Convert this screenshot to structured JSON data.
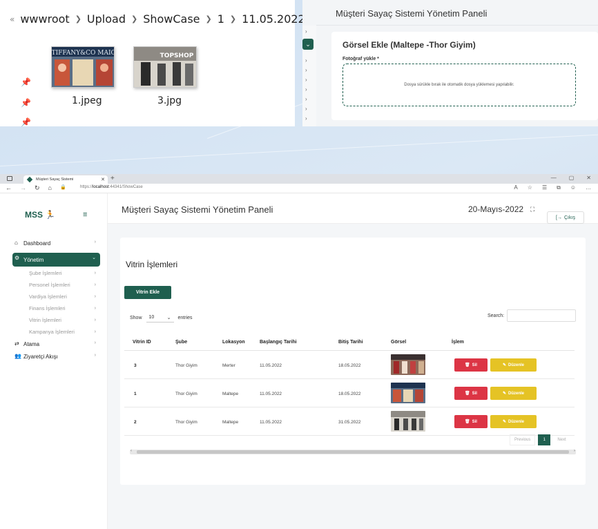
{
  "explorer": {
    "breadcrumb": [
      "wwwroot",
      "Upload",
      "ShowCase",
      "1",
      "11.05.2022"
    ],
    "files": [
      {
        "name": "1.jpeg",
        "sign": "TIFFANY&CO MAIC"
      },
      {
        "name": "3.jpg",
        "sign": "TOPSHOP"
      }
    ]
  },
  "upload_panel": {
    "header": "Müşteri Sayaç Sistemi Yönetim Paneli",
    "card_title": "Görsel Ekle (Maltepe -Thor Giyim)",
    "field_label": "Fotoğraf yükle *",
    "dropzone_text": "Dosya sürükle bırak ile otomatik dosya yüklemesi yapılabilir."
  },
  "browser": {
    "tab_title": "Müşteri Sayaç Sistemi",
    "url_scheme": "https://",
    "url_host": "localhost",
    "url_rest": ":44341/ShowCase"
  },
  "app": {
    "brand": "MSS",
    "page_title": "Müşteri Sayaç Sistemi Yönetim Paneli",
    "date": "20-Mayıs-2022",
    "logout_label": "Çıkış",
    "menu": {
      "dashboard": "Dashboard",
      "yonetim": "Yönetim",
      "atama": "Atama",
      "ziyaretci": "Ziyaretçi Akışı",
      "subitems": [
        "Şube İşlemleri",
        "Personel İşlemleri",
        "Vardiya İşlemleri",
        "Finans İşlemleri",
        "Vitrin İşlemleri",
        "Kampanya İşlemleri"
      ]
    },
    "content": {
      "title": "Vitrin İşlemleri",
      "add_button": "Vitrin Ekle",
      "show_label": "Show",
      "entries_value": "10",
      "entries_label": "entries",
      "search_label": "Search:",
      "columns": [
        "Vitrin ID",
        "Şube",
        "Lokasyon",
        "Başlangıç Tarihi",
        "Bitiş Tarihi",
        "Görsel",
        "İşlem"
      ],
      "rows": [
        {
          "id": "3",
          "sube": "Thor Giyim",
          "lokasyon": "Merter",
          "baslangic": "11.05.2022",
          "bitis": "18.05.2022",
          "img": "topshop"
        },
        {
          "id": "1",
          "sube": "Thor Giyim",
          "lokasyon": "Maltepe",
          "baslangic": "11.05.2022",
          "bitis": "18.05.2022",
          "img": "tiffany"
        },
        {
          "id": "2",
          "sube": "Thor Giyim",
          "lokasyon": "Maltepe",
          "baslangic": "11.05.2022",
          "bitis": "31.05.2022",
          "img": "store"
        }
      ],
      "delete_label": "Sil",
      "edit_label": "Düzenle",
      "pager": {
        "previous": "Previous",
        "page": "1",
        "next": "Next"
      }
    }
  },
  "colors": {
    "brand": "#1f5f4f",
    "danger": "#dc3545",
    "warning": "#e5c325"
  }
}
